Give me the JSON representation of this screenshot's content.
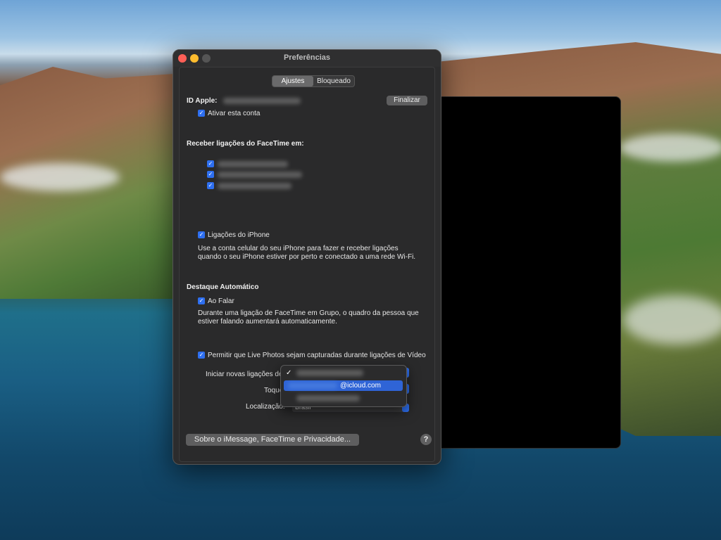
{
  "window": {
    "title": "Preferências"
  },
  "tabs": [
    {
      "label": "Ajustes",
      "active": true
    },
    {
      "label": "Bloqueado",
      "active": false
    }
  ],
  "apple_id": {
    "label": "ID Apple:",
    "finalize_label": "Finalizar",
    "enable_label": "Ativar esta conta"
  },
  "facetime": {
    "heading": "Receber ligações do FaceTime em:"
  },
  "iphone": {
    "label": "Ligações do iPhone",
    "description_line1": "Use a conta celular do seu iPhone para fazer e receber ligações",
    "description_line2": "quando o seu iPhone estiver por perto e conectado a uma rede Wi-Fi."
  },
  "auto_highlight": {
    "heading": "Destaque Automático",
    "speaking_label": "Ao Falar",
    "description_line1": "Durante uma ligação de FaceTime em Grupo, o quadro da pessoa que",
    "description_line2": "estiver falando aumentará automaticamente."
  },
  "live_photos": {
    "label": "Permitir que Live Photos sejam capturadas durante ligações de Vídeo"
  },
  "start_calls": {
    "label": "Iniciar novas ligações de"
  },
  "ringtone": {
    "label": "Toque"
  },
  "location": {
    "label": "Localização:",
    "value": "Brasil"
  },
  "dropdown_menu": {
    "checkmark": "✓",
    "selected_item": "@icloud.com"
  },
  "footer": {
    "about_label": "Sobre o iMessage, FaceTime e Privacidade...",
    "help_label": "?"
  }
}
